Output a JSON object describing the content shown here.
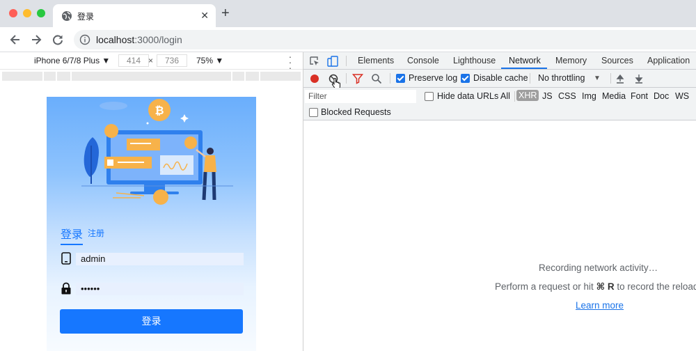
{
  "browser": {
    "tab_title": "登录",
    "tab_close": "✕",
    "new_tab": "+",
    "url_host": "localhost",
    "url_rest": ":3000/login"
  },
  "device_toolbar": {
    "device": "iPhone 6/7/8 Plus ▼",
    "width": "414",
    "height": "736",
    "times": "×",
    "zoom": "75% ▼"
  },
  "app": {
    "tabs": {
      "login": "登录",
      "register": "注册"
    },
    "username_value": "admin",
    "password_value": "••••••",
    "submit_label": "登录"
  },
  "devtools": {
    "tabs": [
      "Elements",
      "Console",
      "Lighthouse",
      "Network",
      "Memory",
      "Sources",
      "Application"
    ],
    "active_tab": "Network",
    "preserve_log": {
      "label": "Preserve log",
      "checked": true
    },
    "disable_cache": {
      "label": "Disable cache",
      "checked": true
    },
    "throttling": "No throttling",
    "throttling_arrow": "▼",
    "filter_placeholder": "Filter",
    "hide_data_urls": {
      "label": "Hide data URLs",
      "checked": false
    },
    "types": [
      "All",
      "XHR",
      "JS",
      "CSS",
      "Img",
      "Media",
      "Font",
      "Doc",
      "WS"
    ],
    "active_type": "XHR",
    "blocked_requests": {
      "label": "Blocked Requests",
      "checked": false
    },
    "empty": {
      "line1": "Recording network activity…",
      "line2_before": "Perform a request or hit ",
      "line2_shortcut": "⌘ R",
      "line2_after": " to record the reload.",
      "learn_more": "Learn more"
    }
  },
  "colors": {
    "accent": "#1a73e8",
    "app_primary": "#1677ff",
    "record": "#d93025"
  }
}
